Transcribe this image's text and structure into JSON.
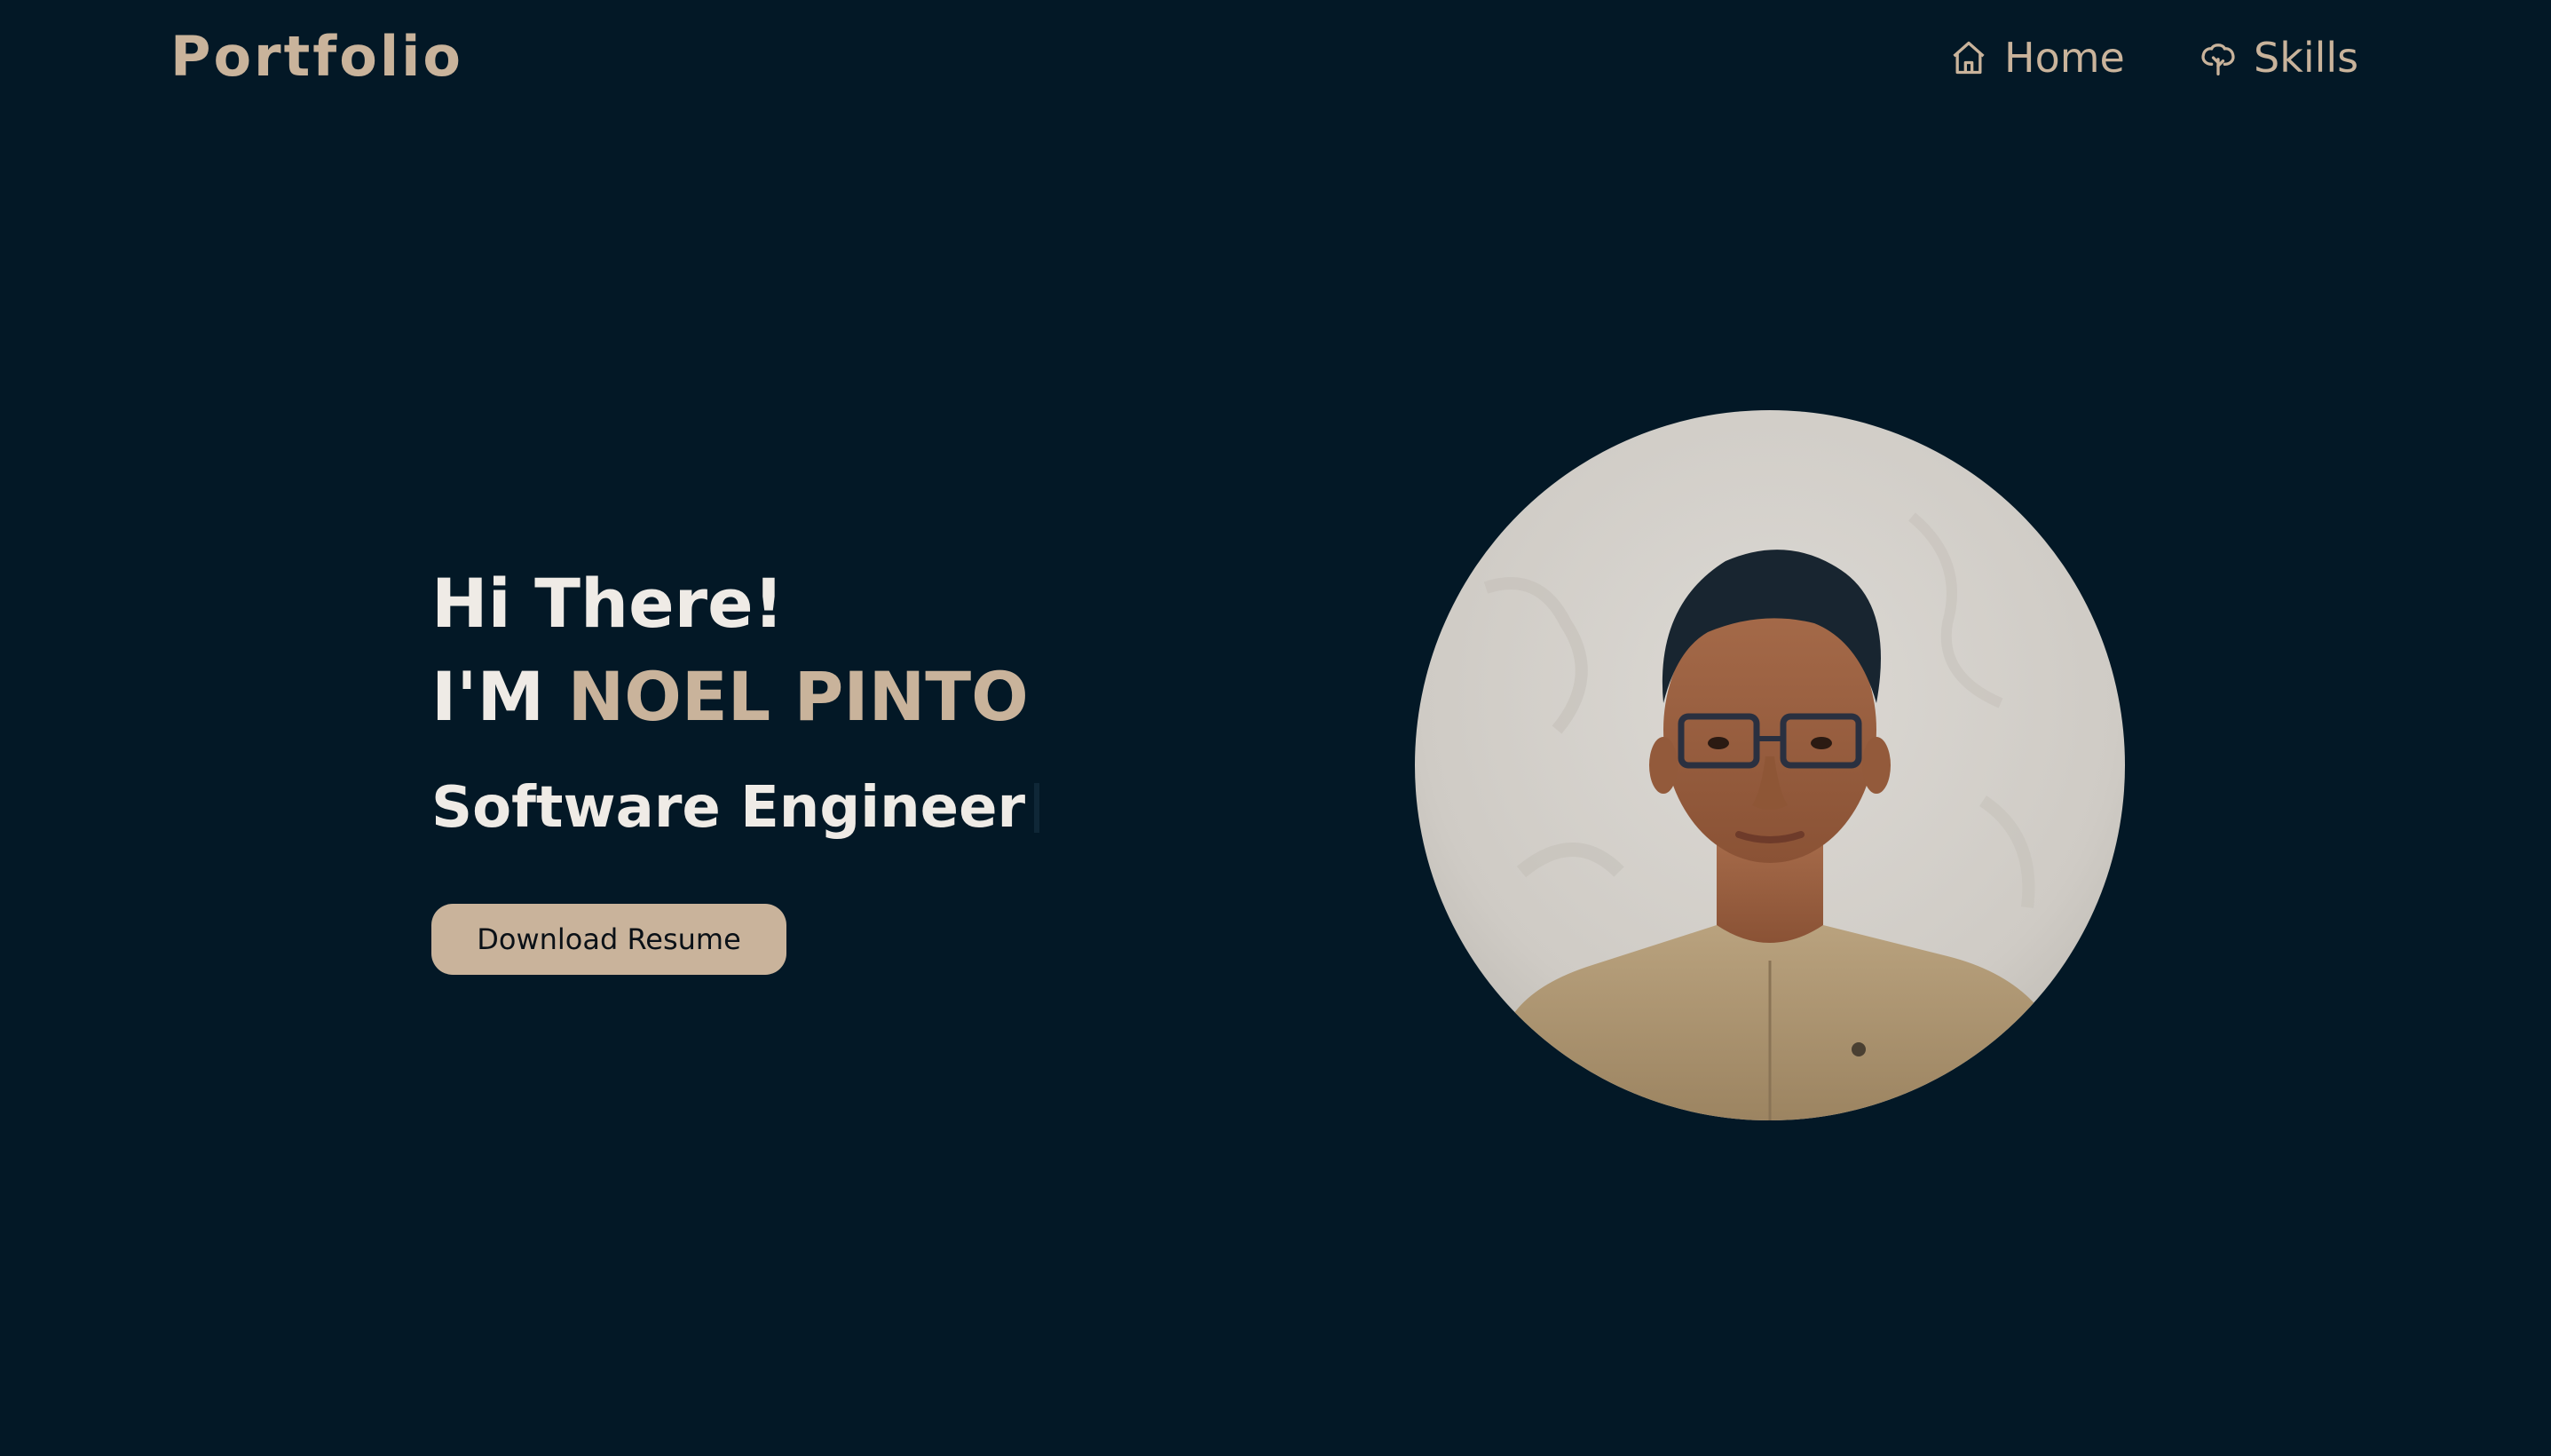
{
  "header": {
    "brand": "Portfolio",
    "nav": [
      {
        "label": "Home",
        "icon": "home-icon"
      },
      {
        "label": "Skills",
        "icon": "tree-icon"
      }
    ]
  },
  "hero": {
    "greeting": "Hi There!",
    "intro_prefix": "I'M ",
    "name": "NOEL PINTO",
    "role": "Software Engineer",
    "download_label": "Download Resume",
    "avatar_icon": "profile-photo"
  },
  "colors": {
    "background": "#031826",
    "accent": "#c9b39b",
    "text": "#efebe6"
  }
}
